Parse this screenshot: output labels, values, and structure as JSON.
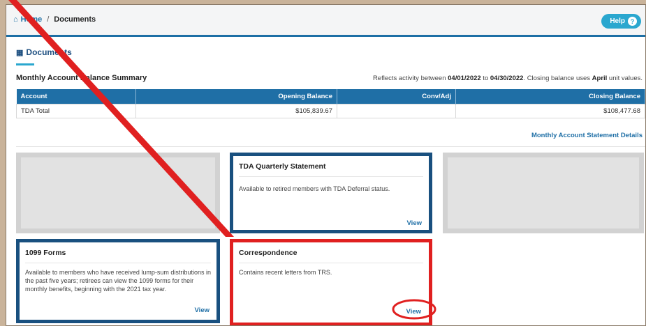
{
  "breadcrumb": {
    "home": "Home",
    "separator": "/",
    "current": "Documents",
    "home_icon": "home-icon"
  },
  "help": {
    "label": "Help",
    "icon": "?"
  },
  "page": {
    "title": "Documents",
    "icon": "document-icon"
  },
  "summary": {
    "title": "Monthly Account Balance Summary",
    "note_prefix": "Reflects activity between ",
    "date_start": "04/01/2022",
    "note_mid": " to ",
    "date_end": "04/30/2022",
    "note_mid2": ". Closing balance uses ",
    "unit_month": "April",
    "note_suffix": " unit values.",
    "columns": [
      "Account",
      "Opening Balance",
      "Conv/Adj",
      "Closing Balance"
    ],
    "rows": [
      {
        "account": "TDA Total",
        "opening": "$105,839.67",
        "conv_adj": "",
        "closing": "$108,477.68"
      }
    ],
    "details_link": "Monthly Account Statement Details"
  },
  "cards": {
    "tda": {
      "title": "TDA Quarterly Statement",
      "body": "Available to retired members with TDA Deferral status.",
      "link": "View"
    },
    "forms1099": {
      "title": "1099 Forms",
      "body": "Available to members who have received lump-sum distributions in the past five years; retirees can view the 1099 forms for their monthly benefits, beginning with the 2021 tax year.",
      "link": "View"
    },
    "correspondence": {
      "title": "Correspondence",
      "body": "Contains recent letters from TRS.",
      "link": "View"
    }
  },
  "colors": {
    "accent": "#1f6fa6",
    "card_border": "#19507f",
    "highlight": "#e02020",
    "help": "#2aa7cf"
  }
}
